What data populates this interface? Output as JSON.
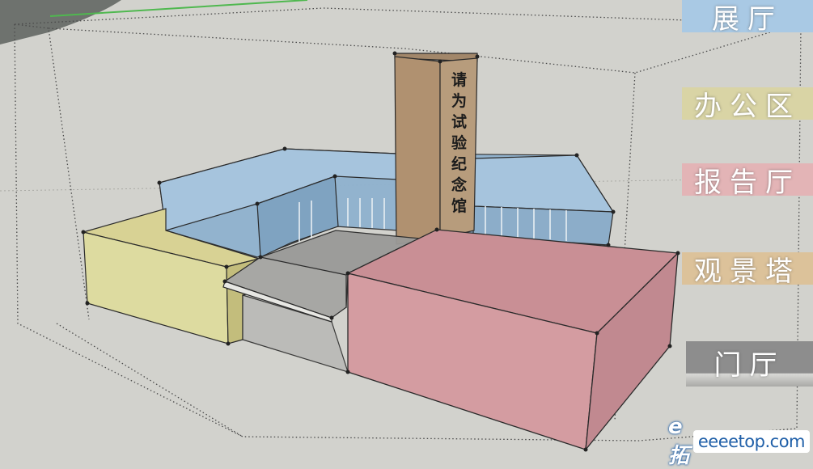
{
  "legend": [
    {
      "label": "展厅",
      "color": "#a9c9e4"
    },
    {
      "label": "办公区",
      "color": "#d9d4a5"
    },
    {
      "label": "报告厅",
      "color": "#e3b4b6"
    },
    {
      "label": "观景塔",
      "color": "#dcc29a"
    },
    {
      "label": "门厅",
      "color": "#8d8d8d"
    }
  ],
  "tower_inscription": [
    "请",
    "为",
    "试",
    "验",
    "纪",
    "念",
    "馆"
  ],
  "watermark": {
    "logo": "e拓",
    "url": "eeeetop.com"
  }
}
